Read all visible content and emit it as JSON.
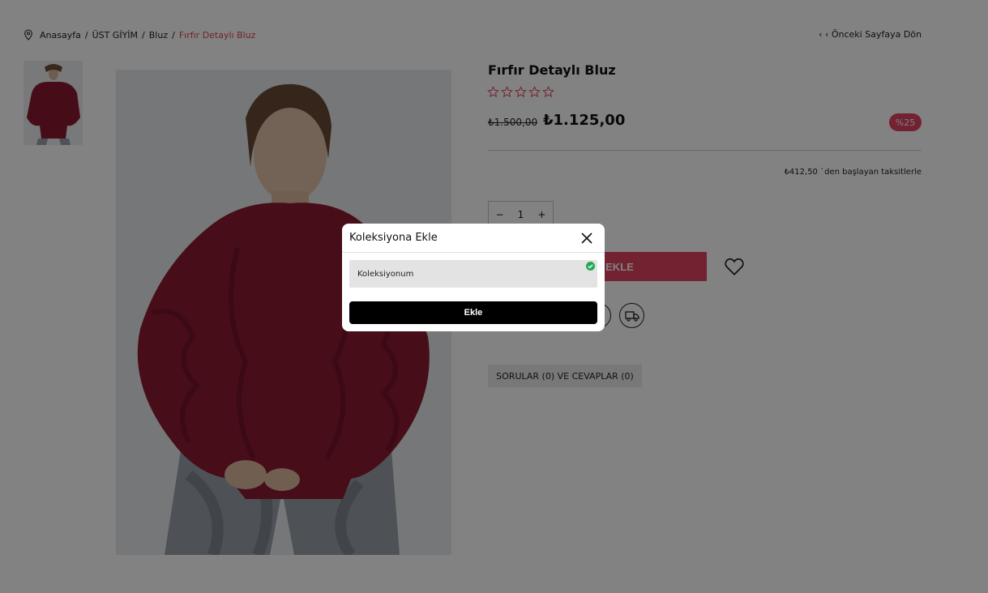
{
  "breadcrumb": {
    "items": [
      "Anasayfa",
      "ÜST GİYİM",
      "Bluz"
    ],
    "current": "Fırfır Detaylı Bluz",
    "separator": "/"
  },
  "back_link": "‹ ‹ Önceki Sayfaya Dön",
  "product": {
    "title": "Fırfır Detaylı Bluz",
    "rating": 0,
    "rating_max": 5,
    "old_price": "₺1.500,00",
    "new_price": "₺1.125,00",
    "discount_badge": "%25",
    "installment_text": "₺412,50 `den başlayan taksitlerle",
    "quantity": "1",
    "qty_minus": "−",
    "qty_plus": "+",
    "add_to_cart_label": "SEPETE EKLE",
    "qa_tab_label": "SORULAR (0) VE CEVAPLAR (0)"
  },
  "modal": {
    "title": "Koleksiyona Ekle",
    "collection_name": "Koleksiyonum",
    "add_button_label": "Ekle"
  },
  "icons": [
    "location-pin-icon",
    "star-icon",
    "heart-icon",
    "truck-icon",
    "close-icon",
    "check-circle-icon"
  ],
  "colors": {
    "accent": "#e0435e",
    "overlay": "rgba(0,0,0,0.49)",
    "check": "#22a852"
  }
}
